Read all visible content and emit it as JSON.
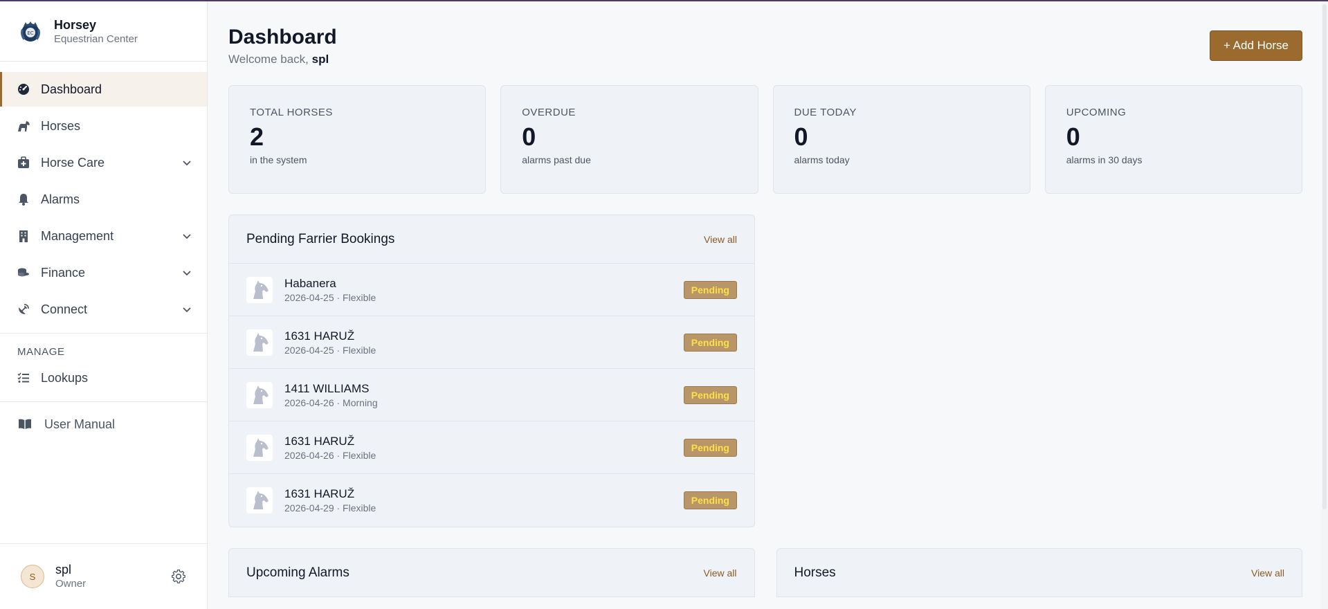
{
  "brand": {
    "name": "Horsey",
    "subtitle": "Equestrian Center"
  },
  "nav": [
    {
      "label": "Dashboard",
      "icon": "gauge-icon",
      "active": true
    },
    {
      "label": "Horses",
      "icon": "horse-icon"
    },
    {
      "label": "Horse Care",
      "icon": "medkit-icon",
      "expandable": true
    },
    {
      "label": "Alarms",
      "icon": "bell-icon"
    },
    {
      "label": "Management",
      "icon": "building-icon",
      "expandable": true
    },
    {
      "label": "Finance",
      "icon": "coins-icon",
      "expandable": true
    },
    {
      "label": "Connect",
      "icon": "satellite-icon",
      "expandable": true
    }
  ],
  "manage": {
    "title": "MANAGE",
    "lookups_label": "Lookups"
  },
  "user_manual": "User Manual",
  "user": {
    "initial": "S",
    "name": "spl",
    "role": "Owner"
  },
  "header": {
    "title": "Dashboard",
    "welcome_prefix": "Welcome back,",
    "username": "spl",
    "add_button": "+ Add Horse"
  },
  "stats": [
    {
      "label": "TOTAL HORSES",
      "value": "2",
      "sub": "in the system"
    },
    {
      "label": "OVERDUE",
      "value": "0",
      "sub": "alarms past due"
    },
    {
      "label": "DUE TODAY",
      "value": "0",
      "sub": "alarms today"
    },
    {
      "label": "UPCOMING",
      "value": "0",
      "sub": "alarms in 30 days"
    }
  ],
  "farrier": {
    "title": "Pending Farrier Bookings",
    "view_all": "View all",
    "bookings": [
      {
        "name": "Habanera",
        "meta": "2026-04-25 · Flexible",
        "status": "Pending"
      },
      {
        "name": "1631 HARUŽ",
        "meta": "2026-04-25 · Flexible",
        "status": "Pending"
      },
      {
        "name": "1411 WILLIAMS",
        "meta": "2026-04-26 · Morning",
        "status": "Pending"
      },
      {
        "name": "1631 HARUŽ",
        "meta": "2026-04-26 · Flexible",
        "status": "Pending"
      },
      {
        "name": "1631 HARUŽ",
        "meta": "2026-04-29 · Flexible",
        "status": "Pending"
      }
    ]
  },
  "alarms_panel": {
    "title": "Upcoming Alarms",
    "view_all": "View all"
  },
  "horses_panel": {
    "title": "Horses",
    "view_all": "View all"
  },
  "colors": {
    "accent": "#9a6a2e",
    "badge_bg": "#b89668",
    "badge_text": "#fde047"
  }
}
